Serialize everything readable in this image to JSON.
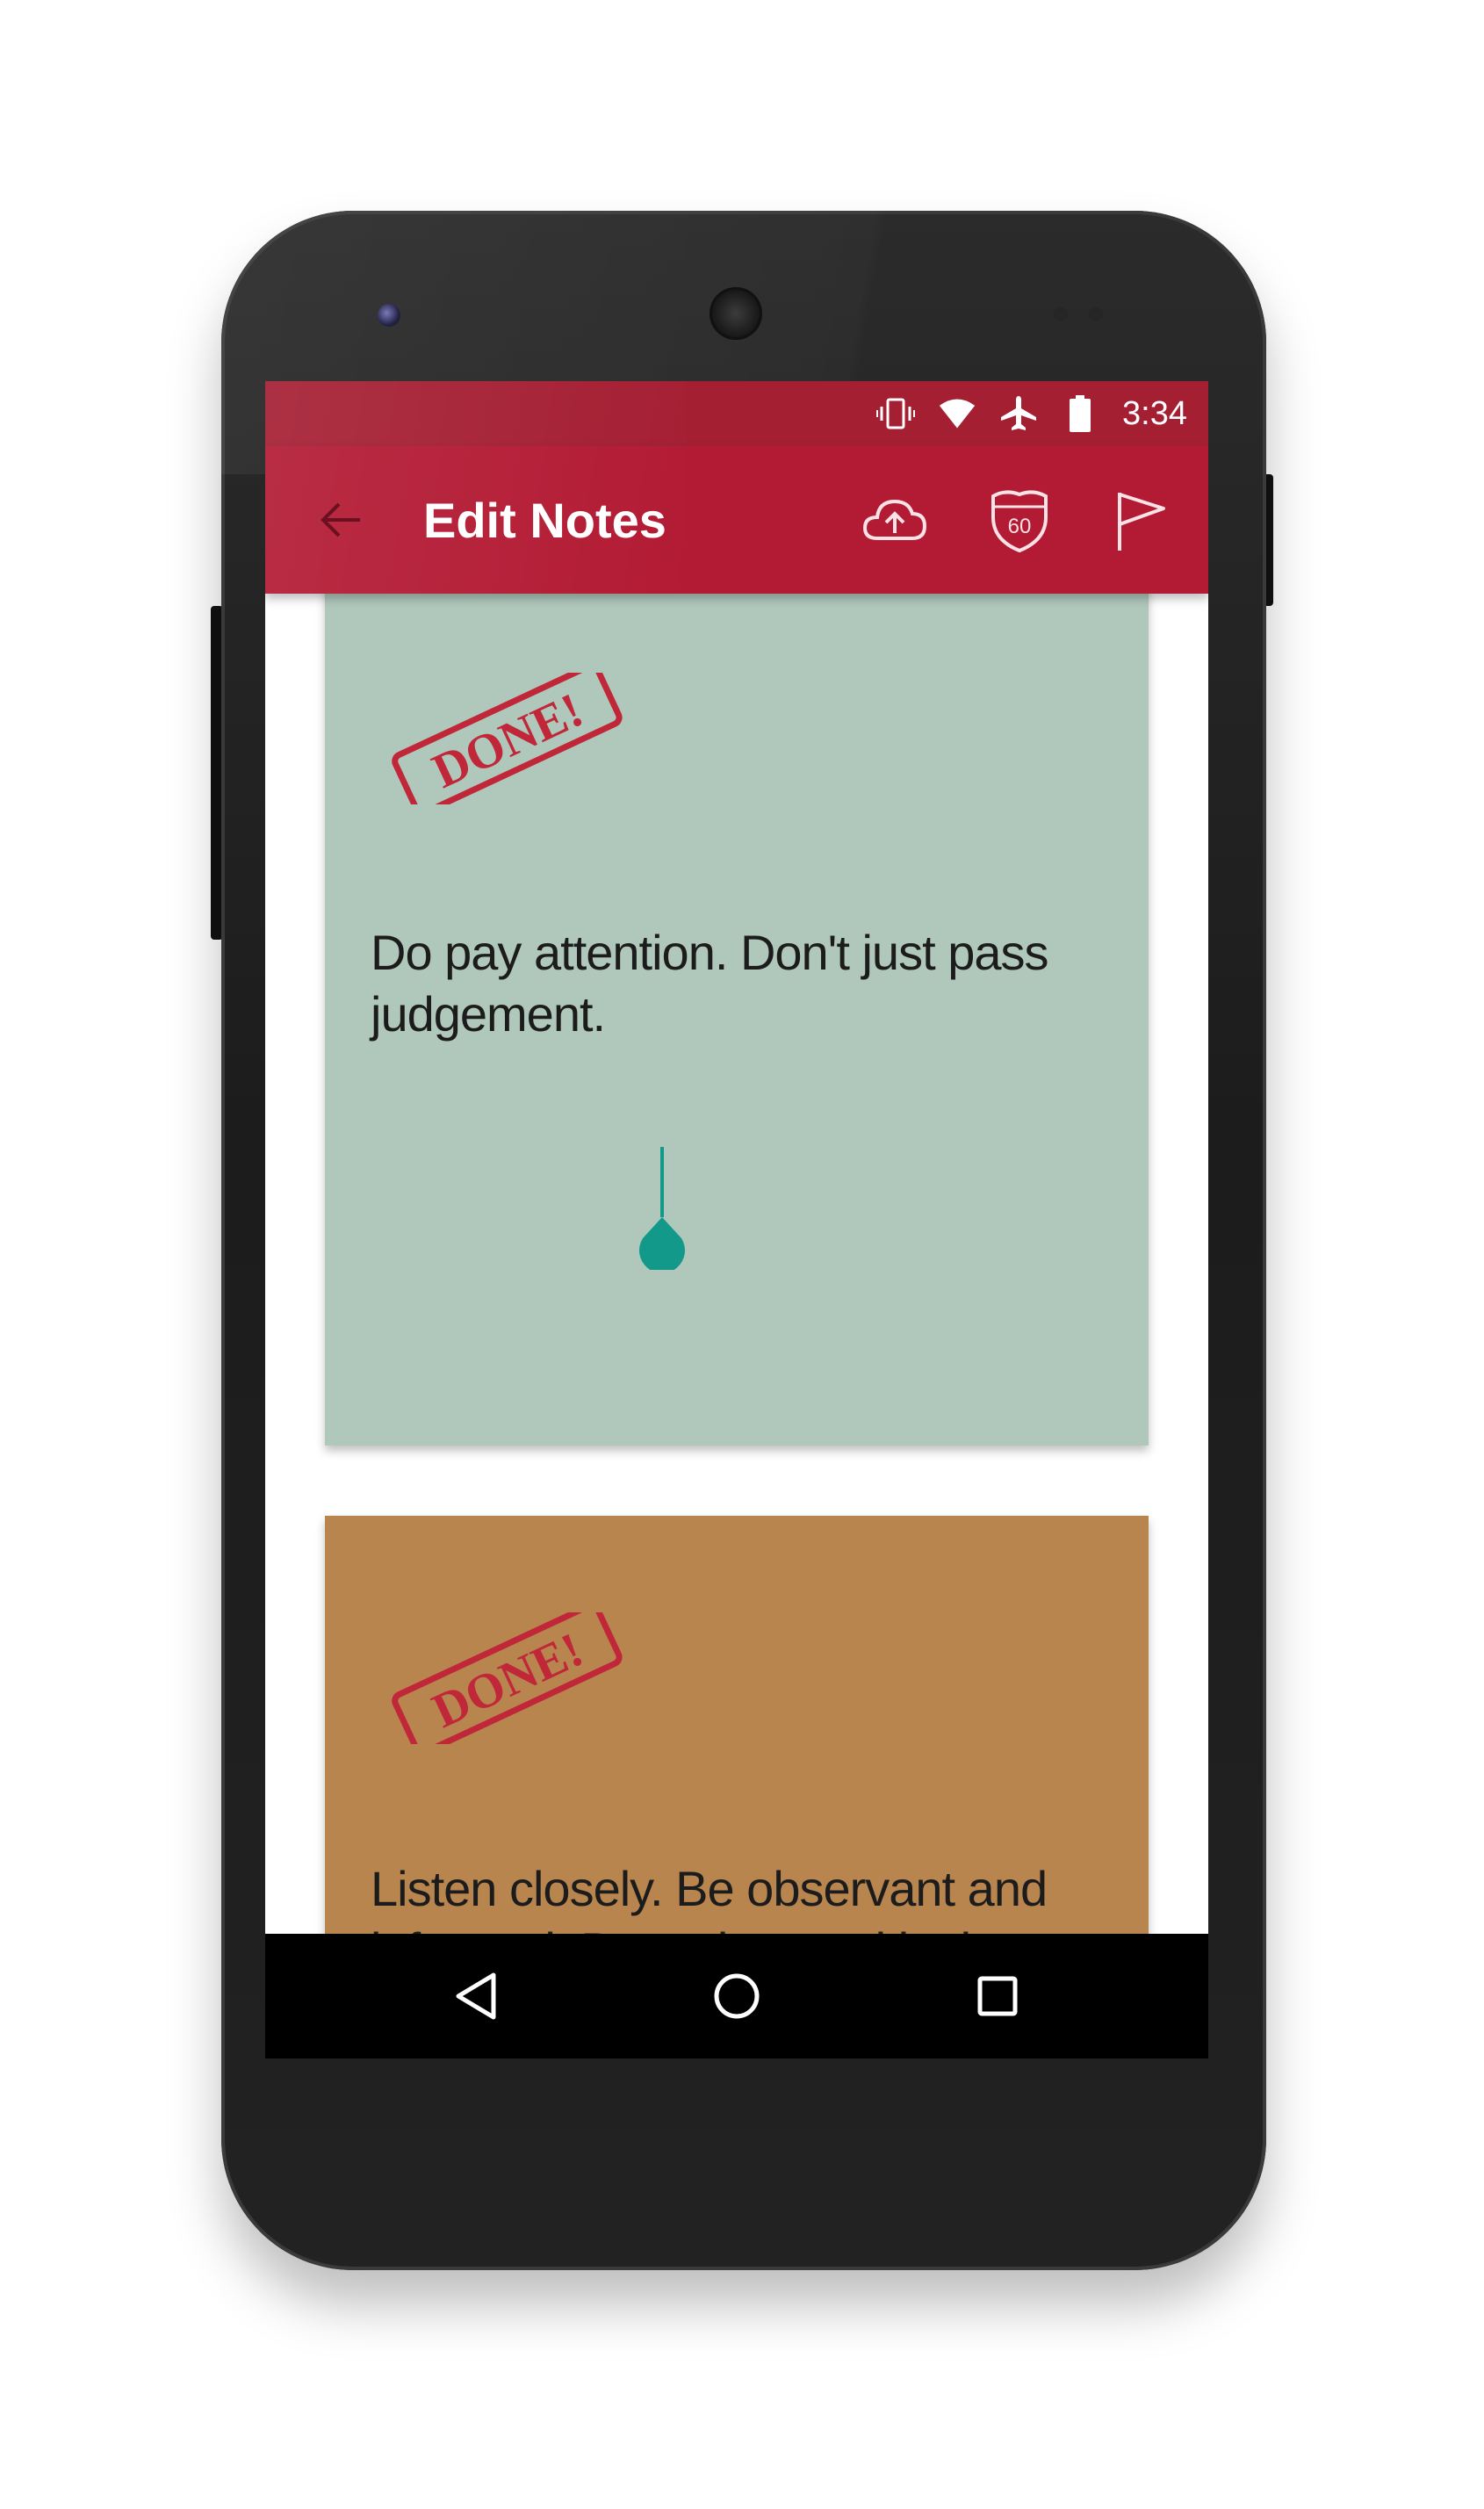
{
  "status_bar": {
    "time": "3:34",
    "icons": [
      "vibrate-icon",
      "wifi-icon",
      "airplane-icon",
      "battery-icon"
    ]
  },
  "app_bar": {
    "title": "Edit Notes",
    "back_icon": "arrow-back-icon",
    "actions": [
      {
        "name": "cloud-upload-button",
        "icon": "cloud-upload-icon"
      },
      {
        "name": "speed-60-button",
        "icon": "highway-shield-icon",
        "label": "60"
      },
      {
        "name": "flag-button",
        "icon": "flag-icon"
      }
    ]
  },
  "notes": [
    {
      "stamp": "DONE!",
      "text": "Do pay attention. Don't just pass judgement.",
      "color": "#b0c8bb"
    },
    {
      "stamp": "DONE!",
      "text": "Listen closely. Be observant and informed. Be patient and in the",
      "color": "#b9854f"
    }
  ],
  "nav_bar": {
    "icons": [
      "nav-back-icon",
      "nav-home-icon",
      "nav-recents-icon"
    ]
  },
  "colors": {
    "status_bar": "#a51f33",
    "app_bar": "#b31b34",
    "stamp_red": "#c0283a",
    "cursor": "#12998a"
  }
}
